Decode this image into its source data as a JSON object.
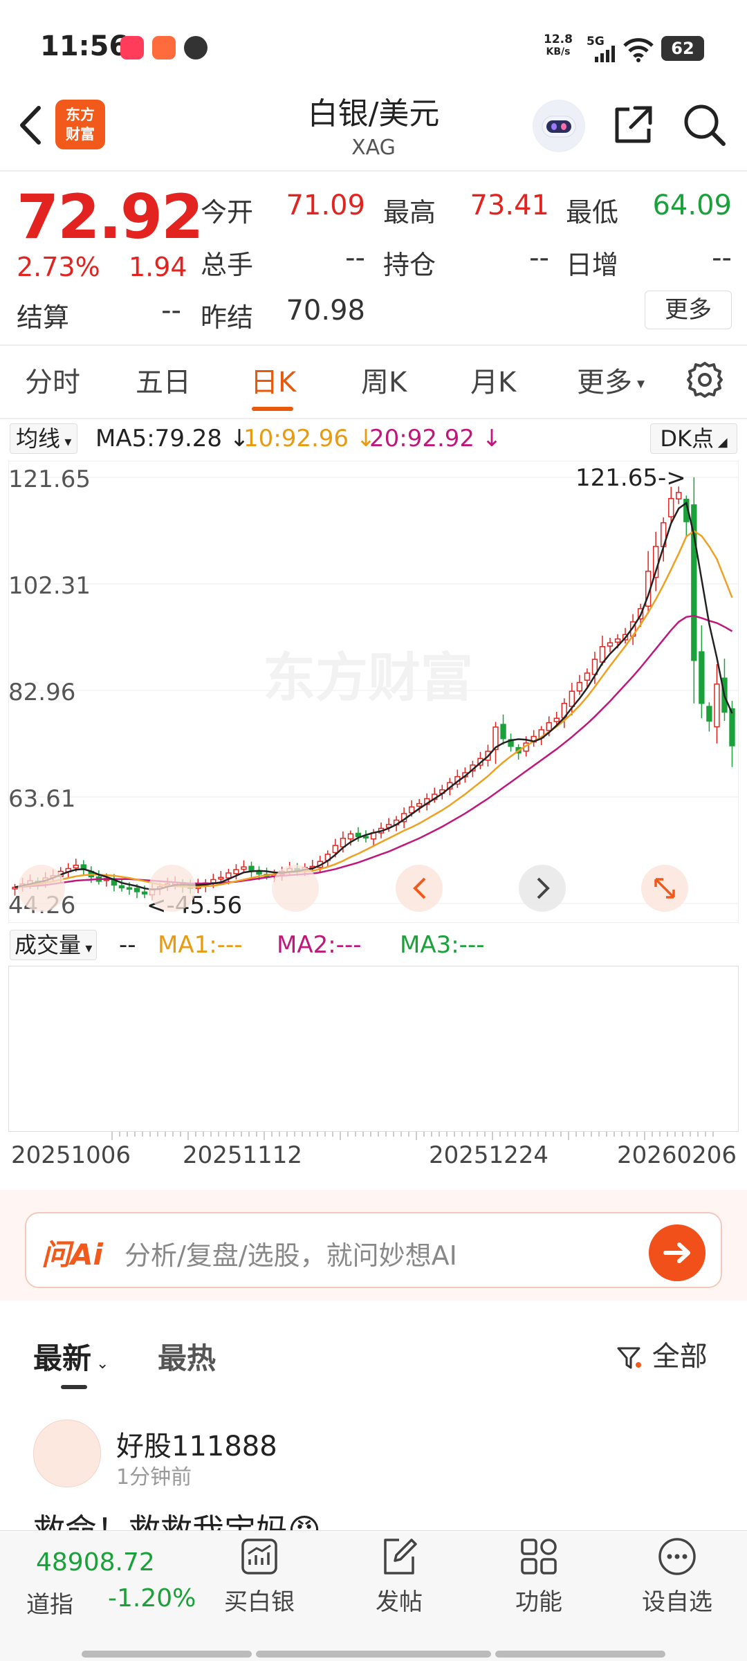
{
  "status_bar": {
    "time": "11:56",
    "net_speed": "12.8",
    "net_speed_unit": "KB/s",
    "network": "5G",
    "battery": "62"
  },
  "header": {
    "title": "白银/美元",
    "subtitle": "XAG",
    "logo_line1": "东方",
    "logo_line2": "财富"
  },
  "quote": {
    "price": "72.92",
    "change_pct": "2.73%",
    "change": "1.94",
    "open_label": "今开",
    "open": "71.09",
    "high_label": "最高",
    "high": "73.41",
    "low_label": "最低",
    "low": "64.09",
    "volume_label": "总手",
    "volume": "--",
    "position_label": "持仓",
    "position": "--",
    "daily_inc_label": "日增",
    "daily_inc": "--",
    "settle_label": "结算",
    "settle": "--",
    "prev_settle_label": "昨结",
    "prev_settle": "70.98",
    "more_label": "更多"
  },
  "tabs": [
    "分时",
    "五日",
    "日K",
    "周K",
    "月K",
    "更多"
  ],
  "active_tab": "日K",
  "indicator_bar": {
    "selector": "均线",
    "ma5": "MA5:79.28 ↓",
    "ma10": "10:92.96 ↓",
    "ma20": "20:92.92 ↓",
    "dk": "DK点"
  },
  "chart_data": {
    "type": "candlestick",
    "y_ticks": [
      "121.65",
      "102.31",
      "82.96",
      "63.61",
      "44.26"
    ],
    "ylim": [
      44.26,
      121.65
    ],
    "max_label": "121.65->",
    "min_label": "<-45.56",
    "x_tick_labels": [
      "20251006",
      "20251112",
      "20251224",
      "20260206"
    ],
    "watermark": "东方财富",
    "up_color": "#e3231f",
    "down_color": "#1aa13a",
    "ma_colors": {
      "ma5": "#222222",
      "ma10": "#f0a020",
      "ma20": "#c0177c"
    },
    "close_approx": [
      47.2,
      47.8,
      48.4,
      48.0,
      48.9,
      49.3,
      50.1,
      50.6,
      51.2,
      50.4,
      49.1,
      48.3,
      48.8,
      47.6,
      47.1,
      46.9,
      46.4,
      46.0,
      46.9,
      47.3,
      47.8,
      48.1,
      47.4,
      47.0,
      47.6,
      48.0,
      48.6,
      49.0,
      49.8,
      50.4,
      50.9,
      50.2,
      49.6,
      49.2,
      49.5,
      50.1,
      50.6,
      50.3,
      50.8,
      51.0,
      51.9,
      53.2,
      54.8,
      56.1,
      56.9,
      56.4,
      56.2,
      57.1,
      57.9,
      58.6,
      59.4,
      60.6,
      61.8,
      62.4,
      63.3,
      64.1,
      64.9,
      66.2,
      67.3,
      68.0,
      69.4,
      70.6,
      71.9,
      76.3,
      74.2,
      72.8,
      71.6,
      73.4,
      74.6,
      75.8,
      77.1,
      77.9,
      80.6,
      82.8,
      84.4,
      86.1,
      88.6,
      90.9,
      91.6,
      92.3,
      93.1,
      95.4,
      97.8,
      104.6,
      109.1,
      113.4,
      117.8,
      118.9,
      113.6,
      88.4,
      80.6,
      77.4,
      84.1,
      79.0,
      72.9
    ],
    "ma5_approx": [
      47.2,
      47.5,
      47.8,
      48.1,
      48.4,
      48.9,
      49.5,
      50.0,
      50.4,
      50.5,
      50.1,
      49.5,
      49.1,
      48.6,
      48.0,
      47.7,
      47.4,
      47.0,
      46.8,
      46.9,
      47.3,
      47.6,
      47.7,
      47.6,
      47.6,
      47.7,
      47.9,
      48.1,
      48.7,
      49.3,
      49.9,
      50.1,
      50.2,
      50.1,
      49.9,
      49.8,
      50.0,
      50.1,
      50.4,
      50.6,
      51.2,
      52.0,
      53.1,
      54.4,
      55.4,
      56.2,
      56.7,
      57.1,
      57.4,
      57.9,
      58.6,
      59.5,
      60.5,
      61.5,
      62.4,
      63.3,
      64.2,
      65.3,
      66.4,
      67.4,
      68.6,
      69.8,
      71.0,
      72.6,
      73.4,
      73.9,
      74.1,
      74.0,
      73.7,
      74.2,
      75.3,
      76.6,
      78.0,
      79.8,
      81.5,
      83.4,
      85.6,
      87.9,
      89.6,
      91.0,
      92.5,
      94.4,
      96.6,
      100.2,
      104.6,
      109.0,
      113.3,
      116.0,
      117.0,
      111.2,
      103.1,
      95.0,
      88.9,
      81.9,
      78.8
    ],
    "ma10_approx": [
      47.2,
      47.4,
      47.6,
      47.8,
      48.0,
      48.3,
      48.6,
      48.9,
      49.2,
      49.4,
      49.5,
      49.5,
      49.4,
      49.3,
      49.1,
      48.9,
      48.6,
      48.3,
      48.0,
      47.7,
      47.5,
      47.4,
      47.3,
      47.3,
      47.3,
      47.4,
      47.5,
      47.7,
      48.0,
      48.3,
      48.6,
      48.9,
      49.2,
      49.4,
      49.6,
      49.8,
      49.9,
      50.0,
      50.1,
      50.2,
      50.5,
      50.9,
      51.4,
      52.0,
      52.7,
      53.3,
      54.0,
      54.7,
      55.4,
      56.1,
      56.8,
      57.5,
      58.1,
      58.8,
      59.6,
      60.4,
      61.2,
      62.1,
      63.1,
      64.1,
      65.2,
      66.3,
      67.4,
      68.7,
      69.9,
      71.0,
      72.0,
      72.9,
      73.7,
      74.5,
      75.4,
      76.4,
      77.5,
      78.8,
      80.2,
      81.8,
      83.6,
      85.5,
      87.4,
      89.2,
      91.0,
      92.9,
      94.9,
      97.1,
      99.5,
      102.1,
      104.9,
      107.8,
      110.9,
      111.9,
      111.0,
      109.1,
      106.8,
      103.3,
      99.8
    ],
    "ma20_approx": [
      47.2,
      47.3,
      47.4,
      47.5,
      47.6,
      47.8,
      48.0,
      48.2,
      48.4,
      48.5,
      48.6,
      48.7,
      48.7,
      48.7,
      48.7,
      48.7,
      48.6,
      48.5,
      48.4,
      48.3,
      48.2,
      48.1,
      48.0,
      47.9,
      47.9,
      47.9,
      47.9,
      48.0,
      48.1,
      48.2,
      48.4,
      48.6,
      48.8,
      49.0,
      49.2,
      49.3,
      49.4,
      49.5,
      49.6,
      49.7,
      49.9,
      50.2,
      50.5,
      50.9,
      51.3,
      51.7,
      52.2,
      52.7,
      53.2,
      53.7,
      54.3,
      54.9,
      55.5,
      56.1,
      56.8,
      57.5,
      58.2,
      59.0,
      59.8,
      60.6,
      61.5,
      62.4,
      63.3,
      64.3,
      65.3,
      66.3,
      67.3,
      68.3,
      69.3,
      70.3,
      71.3,
      72.3,
      73.4,
      74.5,
      75.7,
      76.9,
      78.2,
      79.6,
      81.0,
      82.5,
      84.0,
      85.5,
      87.1,
      88.8,
      90.5,
      92.2,
      93.9,
      95.4,
      96.3,
      96.5,
      96.1,
      95.6,
      95.2,
      94.5,
      93.7
    ]
  },
  "volume_bar": {
    "selector": "成交量",
    "value": "--",
    "ma1": "MA1:---",
    "ma2": "MA2:---",
    "ma3": "MA3:---"
  },
  "ai_bar": {
    "logo": "问Ai",
    "placeholder": "分析/复盘/选股，就问妙想AI"
  },
  "feed": {
    "tabs": [
      "最新",
      "最热"
    ],
    "filter": "全部",
    "post": {
      "user": "好股111888",
      "time": "1分钟前",
      "text": "救命！救救我宝妈😡"
    }
  },
  "bottom_bar": {
    "index_value": "48908.72",
    "index_name": "道指",
    "index_change": "-1.20%",
    "nav": [
      "买白银",
      "发帖",
      "功能",
      "设自选"
    ]
  }
}
